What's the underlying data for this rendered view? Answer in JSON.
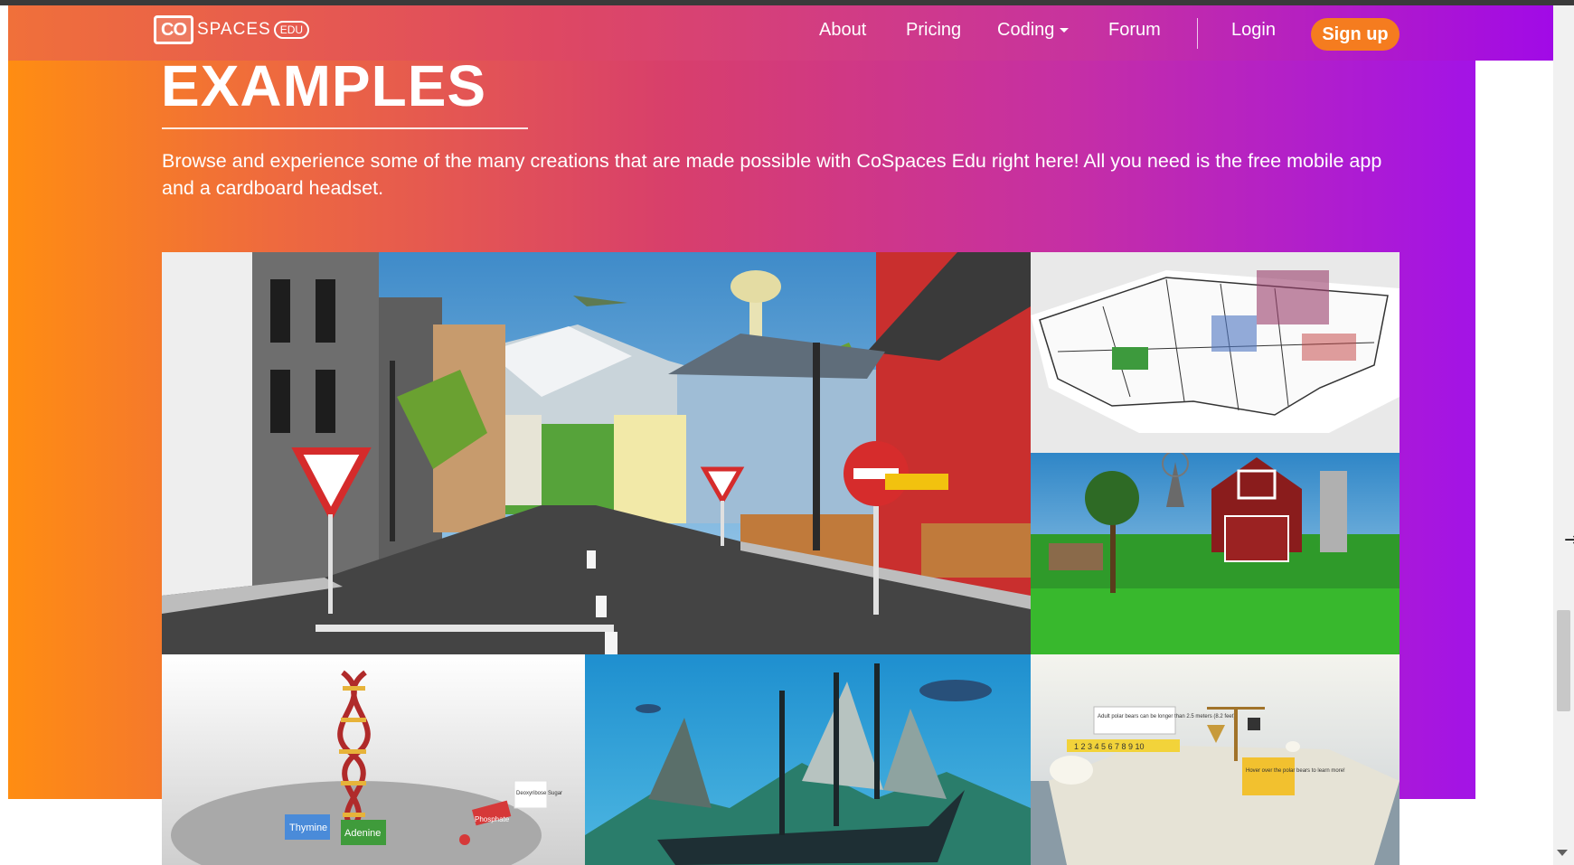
{
  "navbar": {
    "logo_co": "CO",
    "logo_text": "SPACES",
    "logo_edu": "EDU",
    "items": [
      {
        "label": "About"
      },
      {
        "label": "Pricing"
      },
      {
        "label": "Coding"
      },
      {
        "label": "Forum"
      }
    ],
    "login": "Login",
    "signup": "Sign up"
  },
  "page": {
    "title": "EXAMPLES",
    "description": "Browse and experience some of the many creations that are made possible with CoSpaces Edu right here! All you need is the free mobile app and a cardboard headset."
  },
  "gallery": {
    "tiles": [
      {
        "name": "city-street-scene"
      },
      {
        "name": "us-map-scene"
      },
      {
        "name": "farm-scene"
      },
      {
        "name": "dna-scene",
        "labels": [
          "Thymine",
          "Adenine",
          "Phosphate",
          "Deoxyribose Sugar"
        ]
      },
      {
        "name": "shipwreck-scene"
      },
      {
        "name": "polar-bear-scene",
        "labels": [
          "Adult polar bears can be longer than 2.5 meters (8.2 feet).",
          "Hover over the polar bears to learn more!",
          "1 2 3 4 5 6 7 8 9 10"
        ]
      }
    ]
  },
  "colors": {
    "gradient_start": "#ff8d12",
    "gradient_end": "#a313e6",
    "signup_bg": "#f57c1f"
  }
}
